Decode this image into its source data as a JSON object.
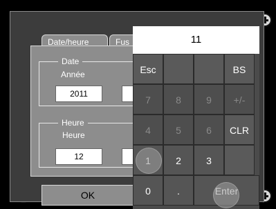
{
  "tabs": {
    "datetime": "Date/heure",
    "second": "Fus"
  },
  "date_group": {
    "title": "Date",
    "year_label": "Année",
    "year_value": "2011"
  },
  "time_group": {
    "title": "Heure",
    "hour_label": "Heure",
    "hour_value": "12"
  },
  "ok_button": "OK",
  "keypad": {
    "display": "11",
    "keys": {
      "esc": "Esc",
      "bs": "BS",
      "k7": "7",
      "k8": "8",
      "k9": "9",
      "sign": "+/-",
      "k4": "4",
      "k5": "5",
      "k6": "6",
      "clr": "CLR",
      "k1": "1",
      "k2": "2",
      "k3": "3",
      "k0": "0",
      "dot": ".",
      "enter": "Enter"
    }
  }
}
